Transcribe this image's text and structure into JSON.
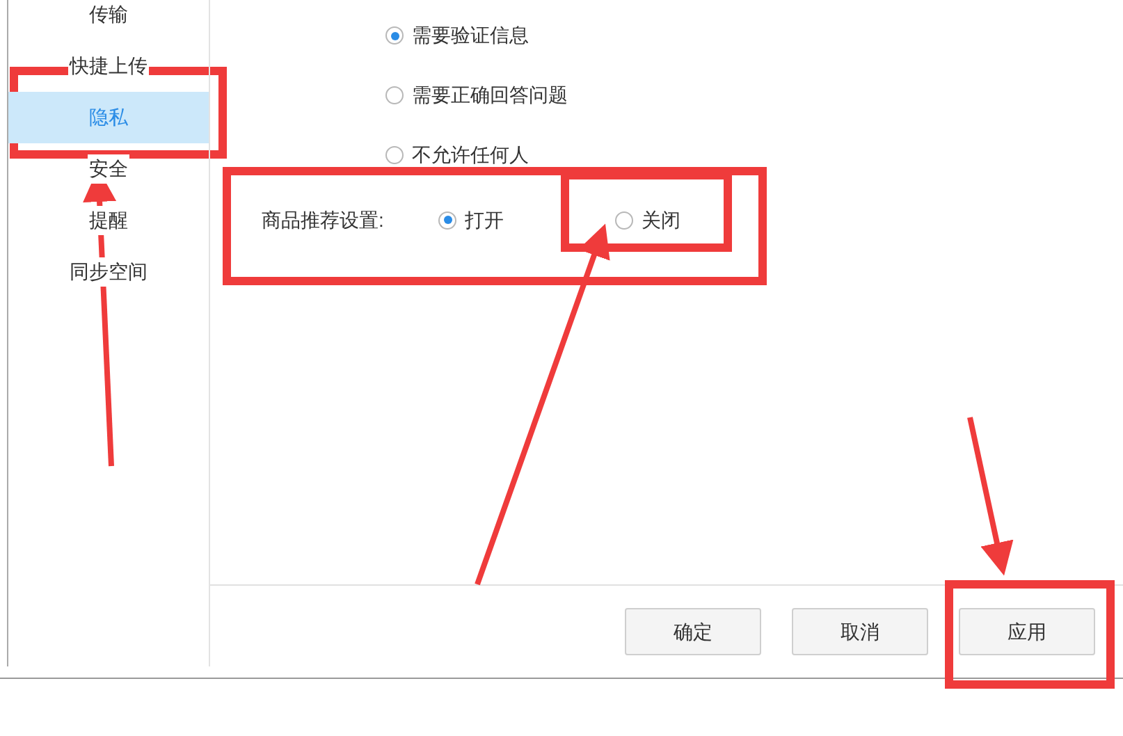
{
  "sidebar": {
    "items": [
      {
        "label": "传输",
        "selected": false
      },
      {
        "label": "快捷上传",
        "selected": false
      },
      {
        "label": "隐私",
        "selected": true
      },
      {
        "label": "安全",
        "selected": false
      },
      {
        "label": "提醒",
        "selected": false
      },
      {
        "label": "同步空间",
        "selected": false
      }
    ]
  },
  "verification": {
    "options": [
      {
        "label": "需要验证信息",
        "selected": true
      },
      {
        "label": "需要正确回答问题",
        "selected": false
      },
      {
        "label": "不允许任何人",
        "selected": false
      }
    ]
  },
  "recommendation": {
    "label": "商品推荐设置:",
    "options": [
      {
        "label": "打开",
        "selected": true
      },
      {
        "label": "关闭",
        "selected": false
      }
    ]
  },
  "buttons": [
    "确定",
    "取消",
    "应用"
  ]
}
